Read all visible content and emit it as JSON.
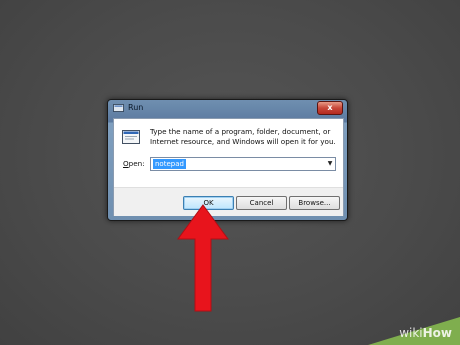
{
  "window": {
    "title": "Run",
    "close_label": "x"
  },
  "dialog": {
    "description": "Type the name of a program, folder, document, or Internet resource, and Windows will open it for you.",
    "open_label_underlined": "O",
    "open_label_rest": "pen:",
    "open_value": "notepad"
  },
  "buttons": {
    "ok": "OK",
    "cancel": "Cancel",
    "browse": "Browse..."
  },
  "watermark": {
    "part1": "wiki",
    "part2": "How"
  },
  "colors": {
    "arrow": "#e8141c",
    "selection": "#3399ff"
  }
}
